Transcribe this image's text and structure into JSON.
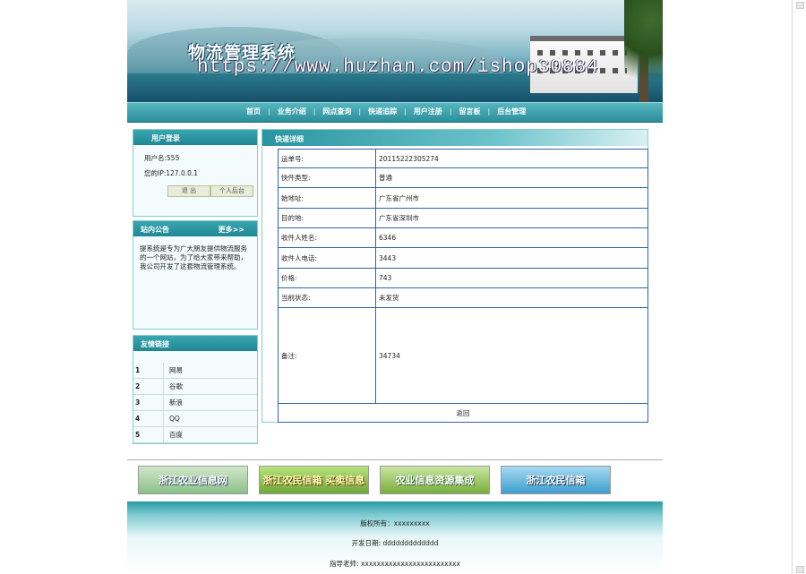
{
  "header": {
    "site_title": "物流管理系统",
    "watermark": "https://www.huzhan.com/ishop30884"
  },
  "nav": {
    "items": [
      "首页",
      "业务介绍",
      "网点查询",
      "快递追踪",
      "用户注册",
      "留言板",
      "后台管理"
    ]
  },
  "login_panel": {
    "title": "用户登录",
    "username": "用户名:555",
    "ip": "您的IP:127.0.0.1",
    "logout_label": "退 出",
    "personal_label": "个人后台"
  },
  "notice_panel": {
    "title": "站内公告",
    "more_label": "更多>>",
    "content": "提系统是专为广大朋友提供物流服务的一个网站，为了给大家带来帮助，我公司开发了这套物流管理系统。"
  },
  "links_panel": {
    "title": "友情链接",
    "items": [
      {
        "num": "1",
        "name": "网易"
      },
      {
        "num": "2",
        "name": "谷歌"
      },
      {
        "num": "3",
        "name": "新浪"
      },
      {
        "num": "4",
        "name": "QQ"
      },
      {
        "num": "5",
        "name": "百度"
      }
    ]
  },
  "detail": {
    "title": "快递详细",
    "rows": [
      {
        "label": "运单号:",
        "value": "20115222305274"
      },
      {
        "label": "快件类型:",
        "value": "普通"
      },
      {
        "label": "始地址:",
        "value": "广东省广州市"
      },
      {
        "label": "目的地:",
        "value": "广东省深圳市"
      },
      {
        "label": "收件人姓名:",
        "value": "6346"
      },
      {
        "label": "收件人电话:",
        "value": "3443"
      },
      {
        "label": "价格:",
        "value": "743"
      },
      {
        "label": "当前状态:",
        "value": "未发货"
      },
      {
        "label": "备注:",
        "value": "34734"
      }
    ],
    "back_label": "返回"
  },
  "partners": [
    "浙江农业信息网",
    "浙江农民信箱 买卖信息",
    "农业信息资源集成",
    "浙江农民信箱"
  ],
  "footer": {
    "copyright": "版权所有：xxxxxxxxx",
    "developer": "开发日期: ddddddddddddd",
    "teacher": "指导老师: xxxxxxxxxxxxxxxxxxxxxxxxx"
  },
  "colors": {
    "nav_bg": "#2a8f9b",
    "panel_head": "#1e8793",
    "table_border": "#2f63a8"
  }
}
